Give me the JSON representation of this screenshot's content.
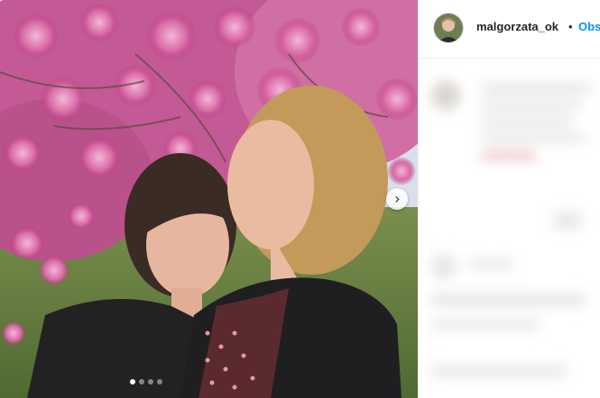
{
  "post": {
    "username": "malgorzata_ok",
    "separator": "•",
    "follow_label": "Obserwuj",
    "carousel": {
      "current_slide": 1,
      "total_slides": 4,
      "next_glyph": "›"
    }
  },
  "icons": {
    "next": "chevron-right-icon",
    "avatar": "profile-photo"
  },
  "colors": {
    "follow_blue": "#0095f6",
    "text_dark": "#262626",
    "border": "#efefef"
  }
}
